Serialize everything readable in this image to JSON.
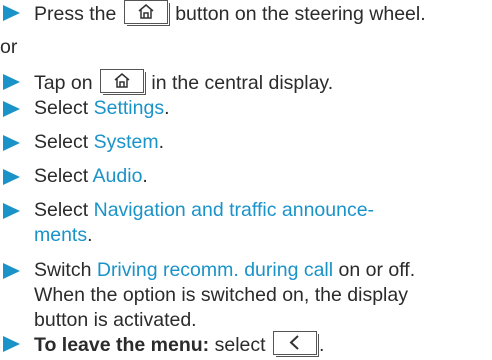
{
  "steps": [
    {
      "pre": "Press the",
      "post": " button on the steering wheel.",
      "icon": "home-icon"
    },
    {
      "or": "or"
    },
    {
      "pre": "Tap on",
      "post": " in the central display.",
      "icon": "home-icon"
    },
    {
      "pre": "Select ",
      "link": "Settings",
      "post": "."
    },
    {
      "pre": "Select ",
      "link": "System",
      "post": "."
    },
    {
      "pre": "Select ",
      "link": "Audio",
      "post": "."
    },
    {
      "pre": "Select ",
      "link_line1": "Navigation and traffic announce-",
      "link_line2": "ments",
      "post": "."
    },
    {
      "pre": "Switch ",
      "link": "Driving recomm. during call",
      "post": " on or off.",
      "line2": "When the option is switched on, the display",
      "line3": "button is activated."
    },
    {
      "bold": "To leave the menu:",
      "post": " select ",
      "icon": "back-icon",
      "end": "."
    }
  ],
  "colors": {
    "accent": "#1a93c8",
    "text": "#2b2b2b"
  }
}
